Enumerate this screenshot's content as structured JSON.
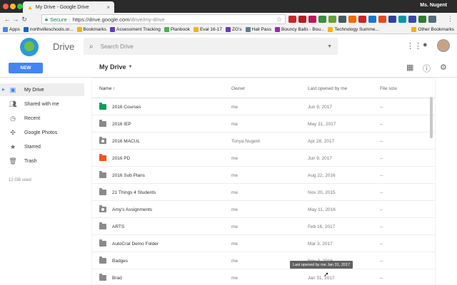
{
  "browser": {
    "tab_title": "My Drive - Google Drive",
    "user_name": "Ms. Nugent",
    "secure_label": "Secure",
    "url_host": "https://drive.google.com",
    "url_path": "/drive/my-drive",
    "bookmarks": [
      {
        "label": "Apps",
        "color": "#4285f4"
      },
      {
        "label": "northvilleschools.or...",
        "color": "#1565c0"
      },
      {
        "label": "Bookmarks",
        "color": "#f4b400"
      },
      {
        "label": "Assessment Tracking",
        "color": "#673ab7"
      },
      {
        "label": "Planbook",
        "color": "#4caf50"
      },
      {
        "label": "Eval 16-17",
        "color": "#f4b400"
      },
      {
        "label": "ZG's",
        "color": "#673ab7"
      },
      {
        "label": "Hall Pass",
        "color": "#607d8b"
      },
      {
        "label": "Bouncy Balls - Bou...",
        "color": "#9c27b0"
      },
      {
        "label": "Technology Summe...",
        "color": "#f4b400"
      }
    ],
    "other_bookmarks": "Other Bookmarks"
  },
  "header": {
    "app_name": "Drive",
    "search_placeholder": "Search Drive",
    "new_label": "NEW",
    "breadcrumb": "My Drive"
  },
  "sidebar": {
    "items": [
      {
        "label": "My Drive",
        "icon": "drive-icon"
      },
      {
        "label": "Shared with me",
        "icon": "people-icon"
      },
      {
        "label": "Recent",
        "icon": "clock-icon"
      },
      {
        "label": "Google Photos",
        "icon": "pinwheel-icon"
      },
      {
        "label": "Starred",
        "icon": "star-icon"
      },
      {
        "label": "Trash",
        "icon": "trash-icon"
      }
    ],
    "storage": "12 GB used"
  },
  "list": {
    "columns": [
      "Name ↑",
      "Owner",
      "Last opened by me",
      "File size"
    ],
    "rows": [
      {
        "name": "2016 Courses",
        "owner": "me",
        "opened": "Jun 9, 2017",
        "size": "--",
        "folder_color": "#0f9d58",
        "shared": false
      },
      {
        "name": "2016 IEP",
        "owner": "me",
        "opened": "May 31, 2017",
        "size": "--",
        "folder_color": "#8a8a8a",
        "shared": false
      },
      {
        "name": "2016 MACUL",
        "owner": "Tonya Nugent",
        "opened": "Apr 28, 2017",
        "size": "--",
        "folder_color": "#8a8a8a",
        "shared": true
      },
      {
        "name": "2016 PD",
        "owner": "me",
        "opened": "Jun 9, 2017",
        "size": "--",
        "folder_color": "#f4511e",
        "shared": false
      },
      {
        "name": "2016 Sub Plans",
        "owner": "me",
        "opened": "Aug 22, 2016",
        "size": "--",
        "folder_color": "#8a8a8a",
        "shared": false
      },
      {
        "name": "21 Things 4 Students",
        "owner": "me",
        "opened": "Nov 20, 2015",
        "size": "--",
        "folder_color": "#8a8a8a",
        "shared": false
      },
      {
        "name": "Amy's Assignments",
        "owner": "me",
        "opened": "May 11, 2016",
        "size": "--",
        "folder_color": "#8a8a8a",
        "shared": true
      },
      {
        "name": "ARTS",
        "owner": "me",
        "opened": "Feb 16, 2017",
        "size": "--",
        "folder_color": "#8a8a8a",
        "shared": false
      },
      {
        "name": "AutoCrat Demo Folder",
        "owner": "me",
        "opened": "Mar 3, 2017",
        "size": "--",
        "folder_color": "#8a8a8a",
        "shared": false
      },
      {
        "name": "Badges",
        "owner": "me",
        "opened": "Nov 3, 2016",
        "size": "--",
        "folder_color": "#8a8a8a",
        "shared": false
      },
      {
        "name": "Brad",
        "owner": "me",
        "opened": "Jan 31, 2017",
        "size": "--",
        "folder_color": "#8a8a8a",
        "shared": false
      }
    ]
  },
  "tooltip": "Last opened by me Jan 31, 2017"
}
